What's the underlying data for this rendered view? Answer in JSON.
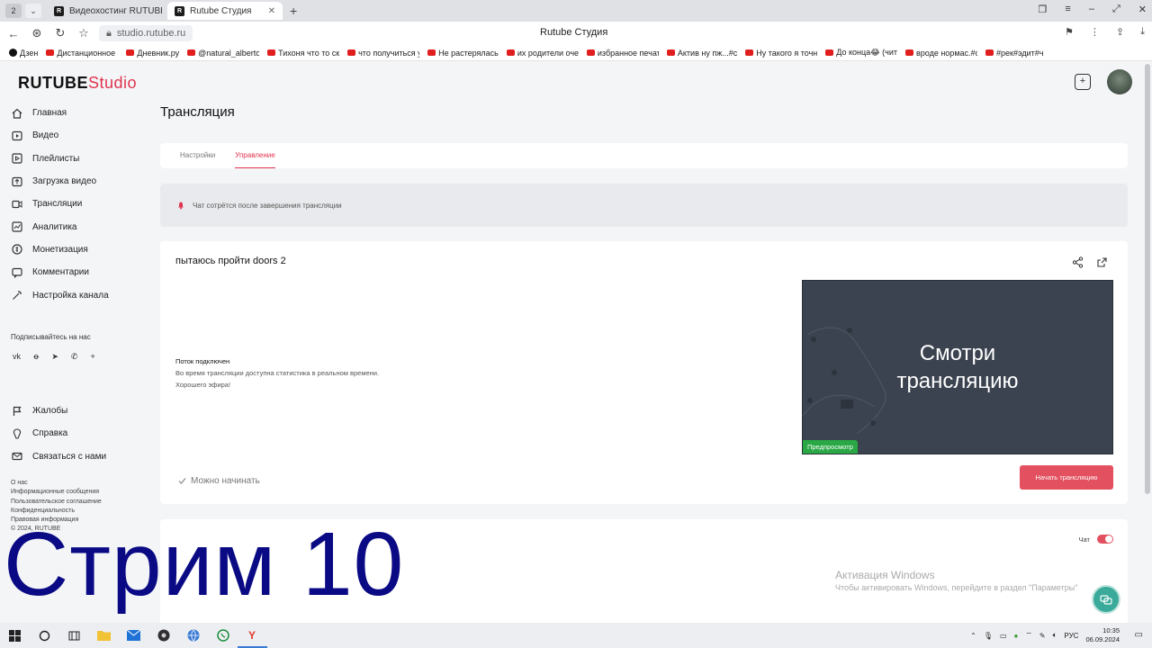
{
  "browser": {
    "tab_count": "2",
    "tabs": [
      {
        "label": "Видеохостинг RUTUBE. С",
        "active": false
      },
      {
        "label": "Rutube Студия",
        "active": true
      }
    ],
    "url": "studio.rutube.ru",
    "page_title": "Rutube Студия",
    "bookmarks": [
      {
        "label": "Дзен",
        "icon": "dzen-icon"
      },
      {
        "label": "Дистанционное с",
        "icon": "youtube-icon"
      },
      {
        "label": "Дневник.ру",
        "icon": "youtube-icon"
      },
      {
        "label": "@natural_alberto",
        "icon": "youtube-icon"
      },
      {
        "label": "Тихоня что то скр",
        "icon": "youtube-icon"
      },
      {
        "label": "что получиться у",
        "icon": "youtube-icon"
      },
      {
        "label": "Не растерялась",
        "icon": "youtube-icon"
      },
      {
        "label": "их родители очен",
        "icon": "youtube-icon"
      },
      {
        "label": "избранное печат",
        "icon": "youtube-icon"
      },
      {
        "label": "Актив ну пж...#с",
        "icon": "youtube-icon"
      },
      {
        "label": "Ну такого я точно",
        "icon": "youtube-icon"
      },
      {
        "label": "До конца😂 (чит",
        "icon": "youtube-icon"
      },
      {
        "label": "вроде нормас.#с",
        "icon": "youtube-icon"
      },
      {
        "label": "#рек#эдит#ч",
        "icon": "youtube-icon"
      }
    ]
  },
  "app": {
    "logo_main": "RUTUBE",
    "logo_sub": "Studio"
  },
  "sidebar": {
    "items": [
      {
        "label": "Главная",
        "icon": "home-icon"
      },
      {
        "label": "Видео",
        "icon": "video-icon"
      },
      {
        "label": "Плейлисты",
        "icon": "playlist-icon"
      },
      {
        "label": "Загрузка видео",
        "icon": "upload-icon"
      },
      {
        "label": "Трансляции",
        "icon": "broadcast-icon"
      },
      {
        "label": "Аналитика",
        "icon": "analytics-icon"
      },
      {
        "label": "Монетизация",
        "icon": "monetization-icon"
      },
      {
        "label": "Комментарии",
        "icon": "comments-icon"
      },
      {
        "label": "Настройка канала",
        "icon": "wand-icon"
      }
    ],
    "follow_label": "Подписывайтесь на нас",
    "socials": [
      "vk-icon",
      "ok-icon",
      "telegram-icon",
      "viber-icon",
      "plus-icon"
    ],
    "secondary_items": [
      {
        "label": "Жалобы",
        "icon": "flag-icon"
      },
      {
        "label": "Справка",
        "icon": "help-icon"
      },
      {
        "label": "Связаться с нами",
        "icon": "mail-icon"
      }
    ],
    "footer_links": [
      "О нас",
      "Информационные сообщения",
      "Пользовательское соглашение",
      "Конфиденциальность",
      "Правовая информация",
      "© 2024, RUTUBE"
    ]
  },
  "main": {
    "title": "Трансляция",
    "tabs": [
      {
        "label": "Настройки",
        "active": false
      },
      {
        "label": "Управление",
        "active": true
      }
    ],
    "notice": "Чат сотрётся после завершения трансляции",
    "stream": {
      "title": "пытаюсь пройти doors 2",
      "status_title": "Поток подключен",
      "status_line1": "Во время трансляции доступна статистика в реальном времени.",
      "status_line2": "Хорошего эфира!",
      "preview_text_line1": "Смотри",
      "preview_text_line2": "трансляцию",
      "preview_badge": "Предпросмотр",
      "ready_label": "Можно начинать",
      "start_button": "Начать трансляцию"
    },
    "chat": {
      "label": "Чат",
      "enabled": true
    }
  },
  "windows_activation": {
    "title": "Активация Windows",
    "subtitle": "Чтобы активировать Windows, перейдите в раздел \"Параметры\""
  },
  "overlay": {
    "text": "Стрим 10"
  },
  "taskbar": {
    "language": "РУС",
    "time": "10:35",
    "date": "06.09.2024"
  },
  "colors": {
    "accent": "#e0344f",
    "button": "#e3505f",
    "preview_bg": "#3b4350",
    "badge_green": "#2aa845",
    "overlay_text": "#0a0a85"
  }
}
